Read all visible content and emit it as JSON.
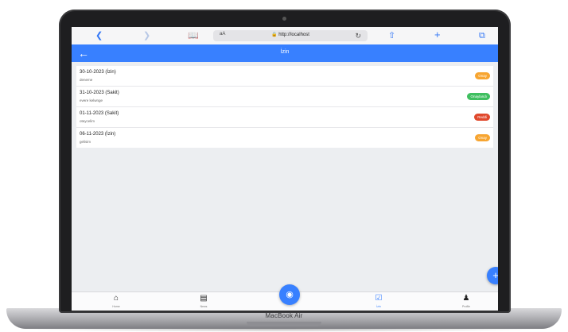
{
  "laptop": {
    "model_label": "MacBook Air"
  },
  "browser": {
    "text_size_label": "aA",
    "url": "🔒 http://localhost",
    "icons": [
      "back-icon",
      "forward-icon",
      "bookmarks-icon",
      "reload-icon",
      "share-icon",
      "new-tab-icon",
      "tabs-icon"
    ]
  },
  "header": {
    "title": "İzin"
  },
  "list": [
    {
      "date": "30-10-2023 (İzin)",
      "sub": "deneme",
      "status": "Onay",
      "color": "#f7a531"
    },
    {
      "date": "31-10-2023 (Sakit)",
      "sub": "evere kelwnge",
      "status": "Onaylandı",
      "color": "#3fbf60"
    },
    {
      "date": "01-11-2023 (Sakit)",
      "sub": "oteycelim",
      "status": "Reddi",
      "color": "#e0492d"
    },
    {
      "date": "06-11-2023 (İzin)",
      "sub": "gelisim",
      "status": "Onay",
      "color": "#f7a531"
    }
  ],
  "fab": {
    "label": "+"
  },
  "tabs": [
    {
      "label": "Home",
      "icon": "home-icon"
    },
    {
      "label": "News",
      "icon": "document-icon"
    },
    {
      "label": "İzin",
      "icon": "calendar-check-icon"
    },
    {
      "label": "Profile",
      "icon": "person-icon"
    }
  ],
  "colors": {
    "primary": "#3880ff",
    "background": "#eceef1",
    "logo": "#b91d1d"
  }
}
